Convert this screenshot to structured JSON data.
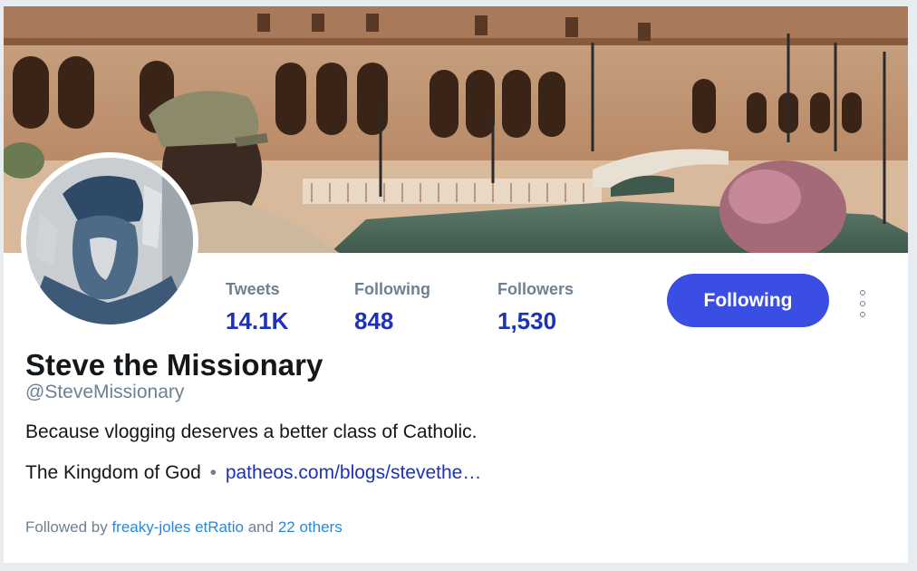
{
  "profile": {
    "display_name": "Steve the Missionary",
    "handle": "@SteveMissionary",
    "bio": "Because vlogging deserves a better class of Catholic.",
    "location": "The Kingdom of God",
    "separator": "•",
    "website": "patheos.com/blogs/stevethe…"
  },
  "stats": {
    "tweets_label": "Tweets",
    "tweets_value": "14.1K",
    "following_label": "Following",
    "following_value": "848",
    "followers_label": "Followers",
    "followers_value": "1,530"
  },
  "actions": {
    "follow_state_label": "Following",
    "more_icon": "vertical-ellipsis-icon"
  },
  "followed_by": {
    "prefix": "Followed by",
    "names": "freaky-joles etRatio",
    "and": "and",
    "others": "22 others"
  },
  "colors": {
    "accent": "#3b4ee4",
    "stat_value": "#1d32b7",
    "muted": "#6e8092",
    "link": "#2a87d6"
  }
}
